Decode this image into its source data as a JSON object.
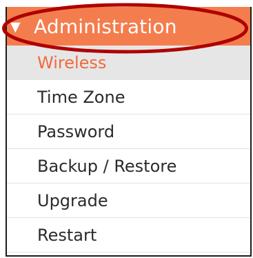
{
  "menu": {
    "section_title": "Administration",
    "section_expanded": true,
    "items": [
      {
        "label": "Wireless",
        "active": true
      },
      {
        "label": "Time Zone",
        "active": false
      },
      {
        "label": "Password",
        "active": false
      },
      {
        "label": "Backup / Restore",
        "active": false
      },
      {
        "label": "Upgrade",
        "active": false
      },
      {
        "label": "Restart",
        "active": false
      }
    ]
  },
  "icons": {
    "expand": "triangle-down-icon"
  },
  "colors": {
    "header_background": "#f47d4e",
    "header_text": "#ffffff",
    "active_item_text": "#f06a3e",
    "active_item_background": "#e6e6e6",
    "item_text": "#2b2b2b",
    "highlight_ring": "#b00000"
  }
}
